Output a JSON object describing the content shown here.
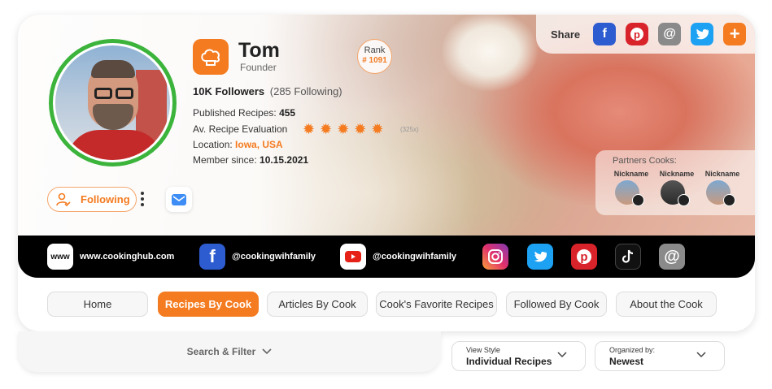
{
  "profile": {
    "name": "Tom",
    "role": "Founder",
    "rank_label": "Rank",
    "rank_value": "# 1091",
    "followers": "10K Followers",
    "following": "(285 Following)",
    "published_label": "Published Recipes:",
    "published_value": "455",
    "evaluation_label": "Av. Recipe Evaluation",
    "evaluation_rating": 5,
    "evaluation_count": "(325x)",
    "location_label": "Location:",
    "location_value": "Iowa, USA",
    "member_label": "Member since:",
    "member_value": "10.15.2021"
  },
  "actions": {
    "follow_label": "Following"
  },
  "share": {
    "label": "Share",
    "icons": [
      "facebook-icon",
      "pinterest-icon",
      "email-icon",
      "twitter-icon",
      "plus-icon"
    ]
  },
  "partners": {
    "title": "Partners Cooks:",
    "items": [
      {
        "name": "Nickname"
      },
      {
        "name": "Nickname"
      },
      {
        "name": "Nickname"
      }
    ]
  },
  "social": {
    "website_badge": "www",
    "website": "www.cookinghub.com",
    "facebook": "@cookingwihfamily",
    "youtube": "@cookingwihfamily",
    "icons": [
      "instagram-icon",
      "twitter-icon",
      "pinterest-icon",
      "tiktok-icon",
      "email-icon"
    ]
  },
  "tabs": [
    {
      "label": "Home",
      "active": false
    },
    {
      "label": "Recipes By Cook",
      "active": true
    },
    {
      "label": "Articles By Cook",
      "active": false
    },
    {
      "label": "Cook's Favorite Recipes",
      "active": false
    },
    {
      "label": "Followed By Cook",
      "active": false
    },
    {
      "label": "About the Cook",
      "active": false
    }
  ],
  "filter": {
    "label": "Search & Filter"
  },
  "view_style": {
    "caption": "View Style",
    "value": "Individual Recipes"
  },
  "organized_by": {
    "caption": "Organized by:",
    "value": "Newest"
  },
  "colors": {
    "accent": "#f47b20",
    "avatar_ring": "#3cb43c",
    "facebook": "#2d5bd0",
    "pinterest": "#d8232a",
    "twitter": "#1da1f2"
  }
}
